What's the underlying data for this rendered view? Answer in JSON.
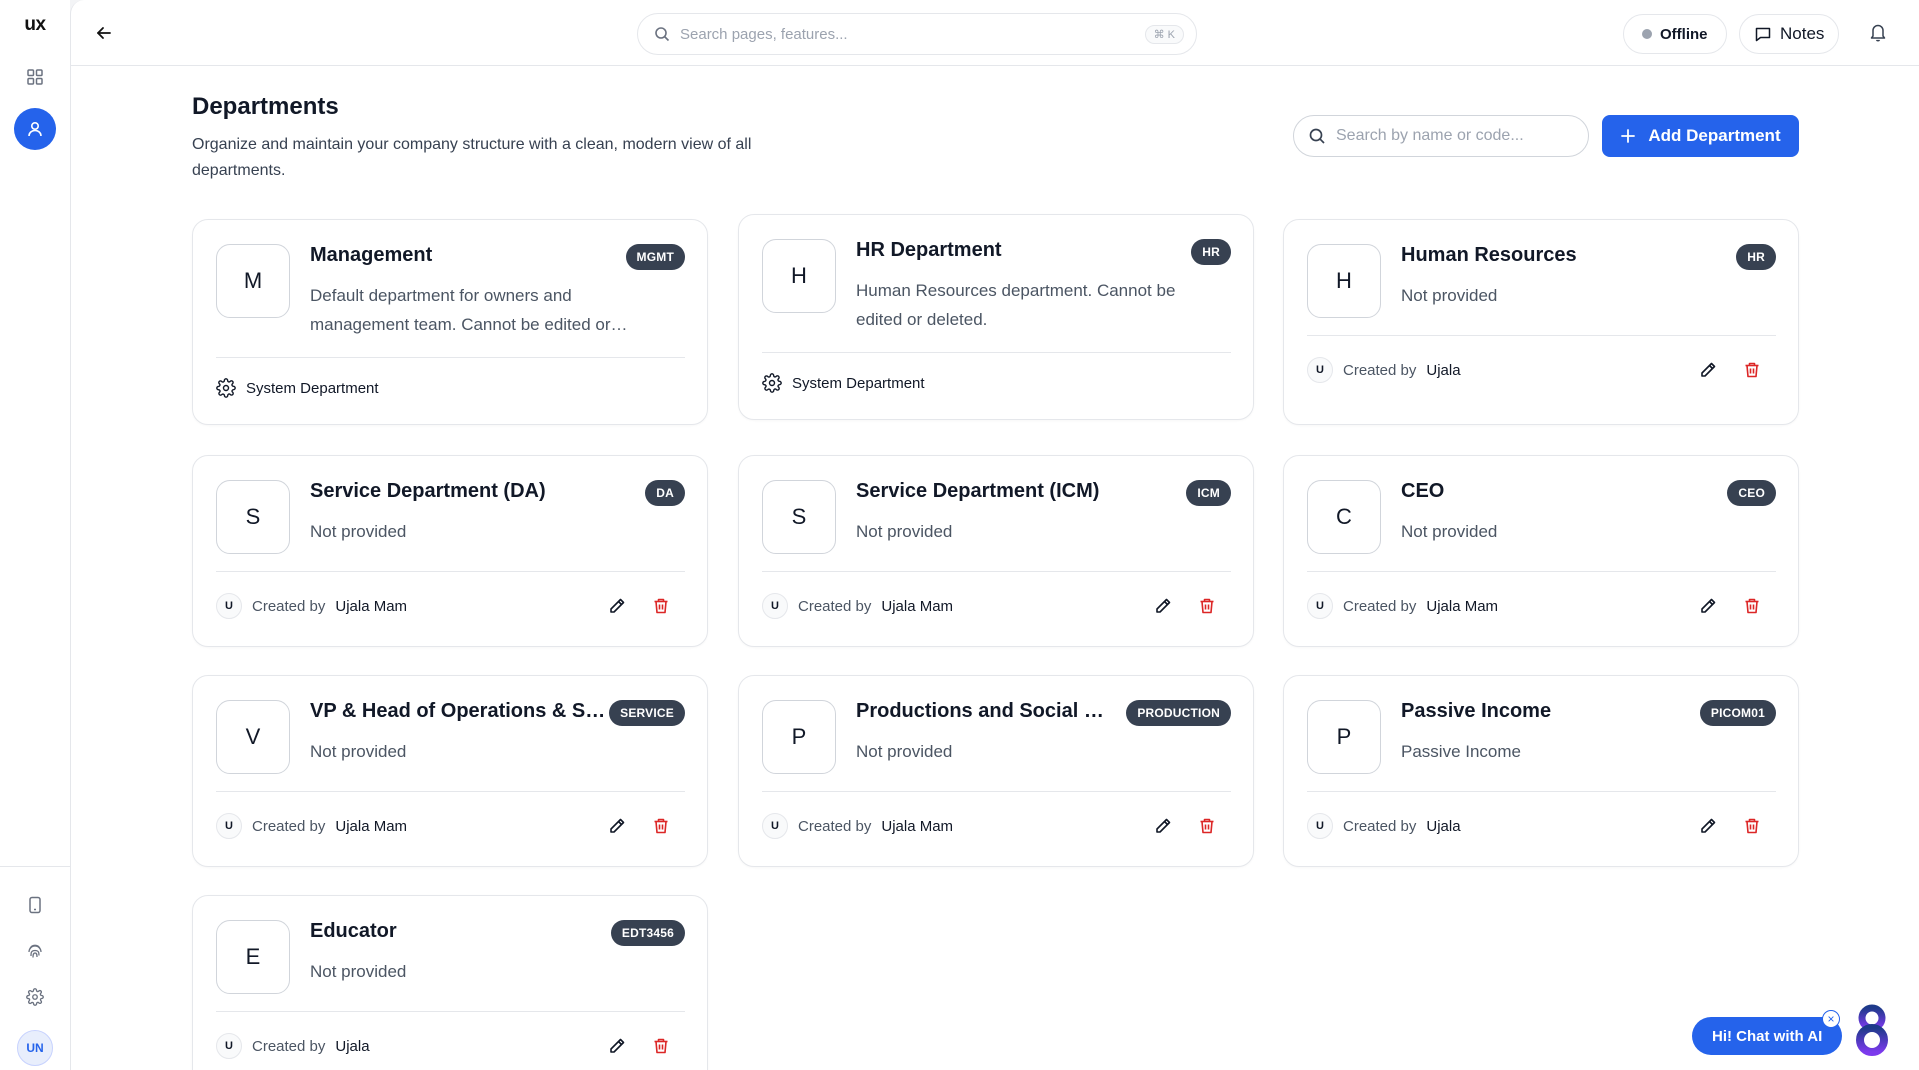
{
  "app": {
    "logo": "ux"
  },
  "sidebar": {
    "items": [
      {
        "icon": "grid-icon"
      },
      {
        "icon": "user-icon",
        "active": true
      }
    ],
    "bottom": [
      {
        "icon": "phone-icon"
      },
      {
        "icon": "fingerprint-icon"
      },
      {
        "icon": "gear-icon"
      }
    ],
    "avatar_initials": "UN"
  },
  "topbar": {
    "search_placeholder": "Search pages, features...",
    "shortcut": "⌘ K",
    "status": "Offline",
    "notes_label": "Notes"
  },
  "page": {
    "title": "Departments",
    "description": "Organize and maintain your company structure with a clean, modern view of all departments.",
    "search_placeholder": "Search by name or code...",
    "add_button": "Add Department"
  },
  "created_by_prefix": "Created by",
  "departments": [
    {
      "initial": "M",
      "name": "Management",
      "code": "MGMT",
      "description": "Default department for owners and management team. Cannot be edited or deleted.",
      "system": true,
      "system_label": "System Department"
    },
    {
      "initial": "H",
      "name": "HR Department",
      "code": "HR",
      "description": "Human Resources department. Cannot be edited or deleted.",
      "system": true,
      "system_label": "System Department"
    },
    {
      "initial": "H",
      "name": "Human Resources",
      "code": "HR",
      "description": "Not provided",
      "system": false,
      "creator": "Ujala"
    },
    {
      "initial": "S",
      "name": "Service Department (DA)",
      "code": "DA",
      "description": "Not provided",
      "system": false,
      "creator": "Ujala Mam"
    },
    {
      "initial": "S",
      "name": "Service Department (ICM)",
      "code": "ICM",
      "description": "Not provided",
      "system": false,
      "creator": "Ujala Mam"
    },
    {
      "initial": "C",
      "name": "CEO",
      "code": "CEO",
      "description": "Not provided",
      "system": false,
      "creator": "Ujala Mam"
    },
    {
      "initial": "V",
      "name": "VP & Head of Operations & Service",
      "code": "SERVICE",
      "description": "Not provided",
      "system": false,
      "creator": "Ujala Mam"
    },
    {
      "initial": "P",
      "name": "Productions and Social Media",
      "code": "PRODUCTION",
      "description": "Not provided",
      "system": false,
      "creator": "Ujala Mam"
    },
    {
      "initial": "P",
      "name": "Passive Income",
      "code": "PICOM01",
      "description": "Passive Income",
      "system": false,
      "creator": "Ujala"
    },
    {
      "initial": "E",
      "name": "Educator",
      "code": "EDT3456",
      "description": "Not provided",
      "system": false,
      "creator": "Ujala"
    }
  ],
  "chat": {
    "label": "Hi! Chat with AI",
    "close": "×"
  },
  "colors": {
    "accent": "#2563eb",
    "badge": "#374151",
    "delete": "#dc2626"
  }
}
